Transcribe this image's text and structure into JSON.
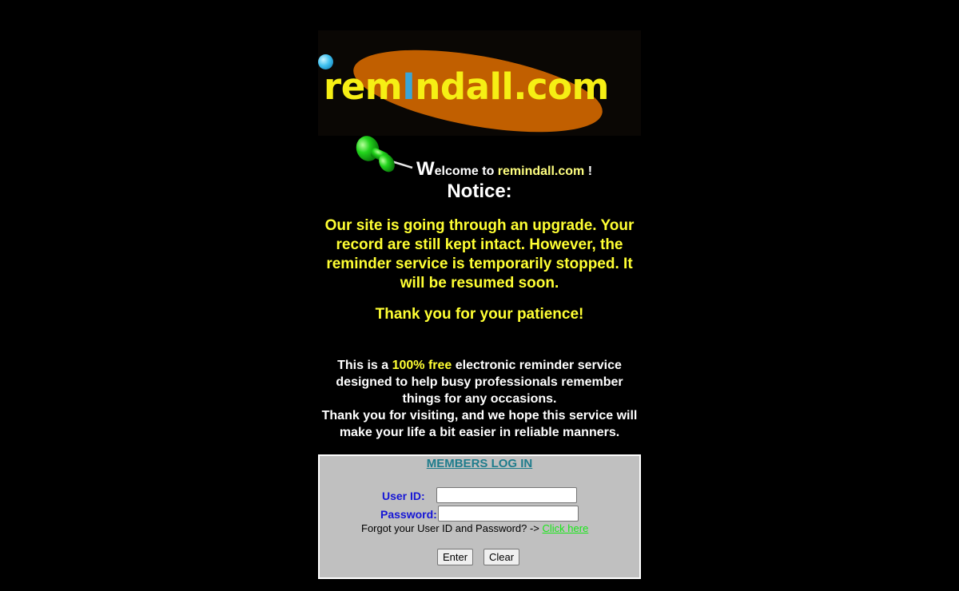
{
  "logo": {
    "prefix": "rem",
    "highlight": "I",
    "suffix": "ndall.com"
  },
  "welcome": {
    "big_letter": "W",
    "rest": "elcome to ",
    "site": "remindall.com",
    "end": " !"
  },
  "notice": {
    "title": "Notice:",
    "message": "Our site is going through an upgrade. Your record are still kept intact. However, the reminder service is temporarily stopped. It will be resumed soon.",
    "thanks": "Thank you for your patience!"
  },
  "about": {
    "part1": "This is a ",
    "free": "100% free",
    "part2": " electronic reminder service designed to help busy professionals remember things for any occasions.",
    "part3": "Thank you for visiting, and we hope this service will make your life a bit easier in reliable manners."
  },
  "login": {
    "title": "MEMBERS LOG IN",
    "user_label": "User ID:",
    "password_label": "Password:",
    "user_value": "",
    "password_value": "",
    "forgot_text": "Forgot your User ID and Password? -> ",
    "forgot_link": "Click here",
    "enter_label": "Enter",
    "clear_label": "Clear"
  },
  "colors": {
    "background": "#000000",
    "logo_text": "#f6ef14",
    "logo_ellipse": "#c15f00",
    "notice_yellow": "#ffff33",
    "login_title": "#1e7c8c",
    "label_blue": "#1515d6",
    "link_green": "#19e819"
  },
  "icons": [
    "blue-dot-icon",
    "pushpin-icon"
  ]
}
